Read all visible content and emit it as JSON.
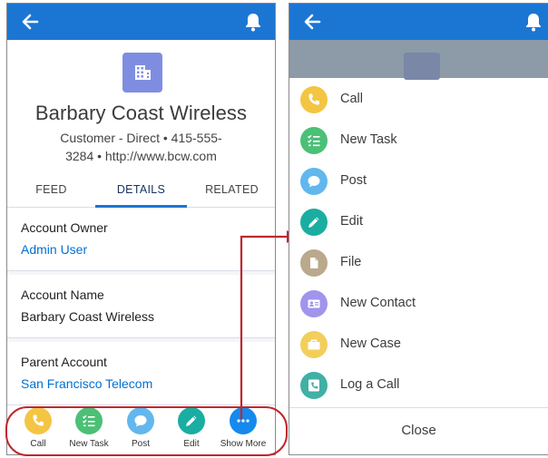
{
  "left_screen": {
    "record": {
      "title": "Barbary Coast Wireless",
      "subtitle_line1": "Customer - Direct • 415-555-",
      "subtitle_line2": "3284 • http://www.bcw.com",
      "icon": "account-building-icon"
    },
    "tabs": [
      {
        "label": "FEED"
      },
      {
        "label": "DETAILS",
        "active": true
      },
      {
        "label": "RELATED"
      }
    ],
    "fields": [
      {
        "label": "Account Owner",
        "value": "Admin User",
        "is_link": true
      },
      {
        "label": "Account Name",
        "value": "Barbary Coast Wireless",
        "is_link": false
      },
      {
        "label": "Parent Account",
        "value": "San Francisco Telecom",
        "is_link": true
      }
    ],
    "action_bar": [
      {
        "label": "Call",
        "icon": "phone-icon",
        "color": "#f4c542"
      },
      {
        "label": "New Task",
        "icon": "task-list-icon",
        "color": "#4bc076"
      },
      {
        "label": "Post",
        "icon": "chat-bubble-icon",
        "color": "#62b7ed"
      },
      {
        "label": "Edit",
        "icon": "pencil-icon",
        "color": "#1bada2"
      },
      {
        "label": "Show More",
        "icon": "more-dots-icon",
        "color": "#1589ee"
      }
    ]
  },
  "right_screen": {
    "menu_items": [
      {
        "label": "Call",
        "icon": "phone-icon",
        "color": "#f4c542"
      },
      {
        "label": "New Task",
        "icon": "task-list-icon",
        "color": "#4bc076"
      },
      {
        "label": "Post",
        "icon": "chat-bubble-icon",
        "color": "#62b7ed"
      },
      {
        "label": "Edit",
        "icon": "pencil-icon",
        "color": "#1bada2"
      },
      {
        "label": "File",
        "icon": "file-icon",
        "color": "#baa98c"
      },
      {
        "label": "New Contact",
        "icon": "contact-card-icon",
        "color": "#a094ed"
      },
      {
        "label": "New Case",
        "icon": "briefcase-icon",
        "color": "#f2cf5b"
      },
      {
        "label": "Log a Call",
        "icon": "log-call-icon",
        "color": "#41b0a5"
      }
    ],
    "close_label": "Close"
  },
  "colors": {
    "header_blue": "#1b76d3",
    "link_blue": "#0070d2",
    "highlight_red": "#c0272d",
    "account_icon": "#7f8de1"
  }
}
